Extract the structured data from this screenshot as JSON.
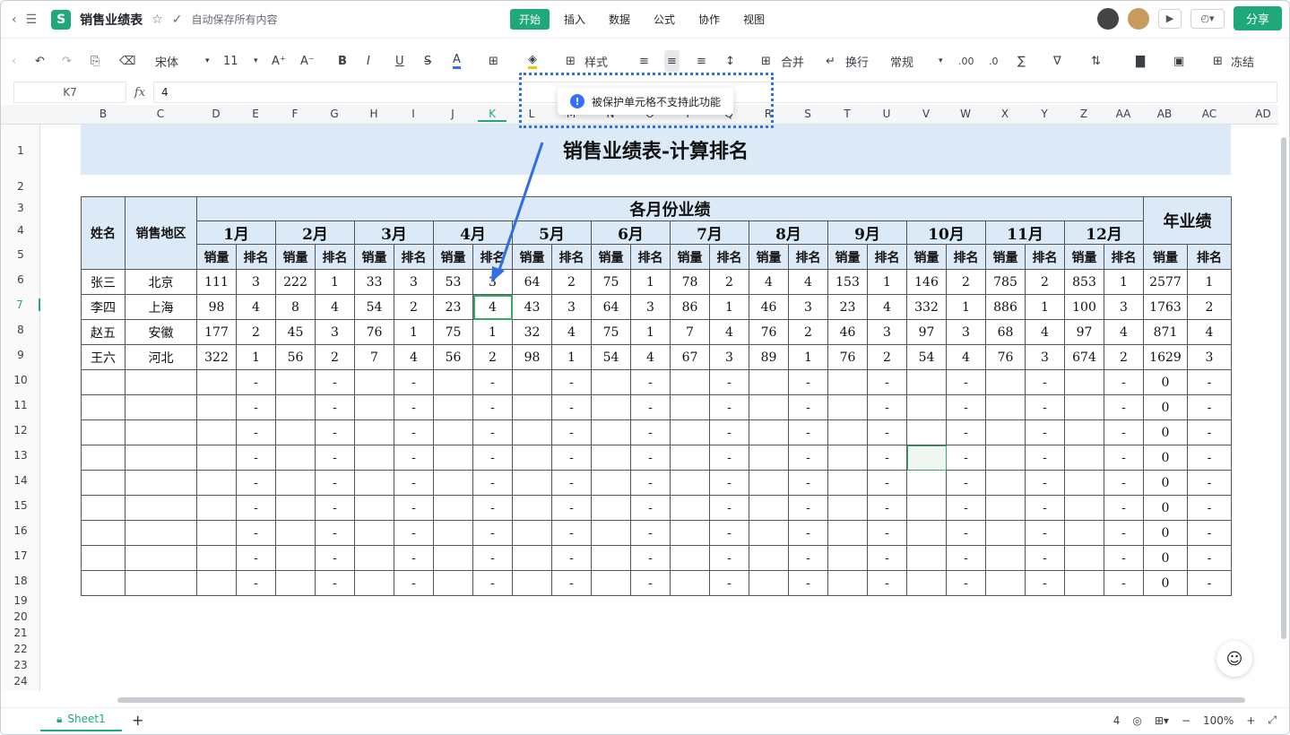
{
  "app": {
    "title": "销售业绩表",
    "autosave": "自动保存所有内容",
    "logo": "S"
  },
  "menu": [
    "开始",
    "插入",
    "数据",
    "公式",
    "协作",
    "视图"
  ],
  "share": "分享",
  "toolbar": {
    "font": "宋体",
    "size": "11",
    "style": "样式",
    "merge": "合并",
    "wrap": "换行",
    "format": "常规",
    "freeze": "冻结"
  },
  "formula": {
    "cell": "K7",
    "fx": "fx",
    "value": "4"
  },
  "toast": {
    "message": "被保护单元格不支持此功能"
  },
  "columns": [
    "B",
    "C",
    "D",
    "E",
    "F",
    "G",
    "H",
    "I",
    "J",
    "K",
    "L",
    "M",
    "N",
    "O",
    "P",
    "Q",
    "R",
    "S",
    "T",
    "U",
    "V",
    "W",
    "X",
    "Y",
    "Z",
    "AA",
    "AB",
    "AC",
    "AD"
  ],
  "rows": [
    "1",
    "2",
    "3",
    "4",
    "5",
    "6",
    "7",
    "8",
    "9",
    "10",
    "11",
    "12",
    "13",
    "14",
    "15",
    "16",
    "17",
    "18",
    "19",
    "20",
    "21",
    "22",
    "23",
    "24"
  ],
  "sheet": {
    "title": "销售业绩表-计算排名",
    "h_name": "姓名",
    "h_region": "销售地区",
    "h_monthly": "各月份业绩",
    "h_annual": "年业绩",
    "months": [
      "1月",
      "2月",
      "3月",
      "4月",
      "5月",
      "6月",
      "7月",
      "8月",
      "9月",
      "10月",
      "11月",
      "12月"
    ],
    "sub_qty": "销量",
    "sub_rank": "排名",
    "people": [
      {
        "name": "张三",
        "region": "北京",
        "data": [
          "111",
          "3",
          "222",
          "1",
          "33",
          "3",
          "53",
          "3",
          "64",
          "2",
          "75",
          "1",
          "78",
          "2",
          "4",
          "4",
          "153",
          "1",
          "146",
          "2",
          "785",
          "2",
          "853",
          "1",
          "2577",
          "1"
        ]
      },
      {
        "name": "李四",
        "region": "上海",
        "data": [
          "98",
          "4",
          "8",
          "4",
          "54",
          "2",
          "23",
          "4",
          "43",
          "3",
          "64",
          "3",
          "86",
          "1",
          "46",
          "3",
          "23",
          "4",
          "332",
          "1",
          "886",
          "1",
          "100",
          "3",
          "1763",
          "2"
        ]
      },
      {
        "name": "赵五",
        "region": "安徽",
        "data": [
          "177",
          "2",
          "45",
          "3",
          "76",
          "1",
          "75",
          "1",
          "32",
          "4",
          "75",
          "1",
          "7",
          "4",
          "76",
          "2",
          "46",
          "3",
          "97",
          "3",
          "68",
          "4",
          "97",
          "4",
          "871",
          "4"
        ]
      },
      {
        "name": "王六",
        "region": "河北",
        "data": [
          "322",
          "1",
          "56",
          "2",
          "7",
          "4",
          "56",
          "2",
          "98",
          "1",
          "54",
          "4",
          "67",
          "3",
          "89",
          "1",
          "76",
          "2",
          "54",
          "4",
          "76",
          "3",
          "674",
          "2",
          "1629",
          "3"
        ]
      }
    ],
    "empty_rank": "-",
    "empty_total": "0"
  },
  "tabs": {
    "sheet1": "Sheet1",
    "add": "+"
  },
  "status": {
    "count": "4",
    "zoom": "100%"
  }
}
